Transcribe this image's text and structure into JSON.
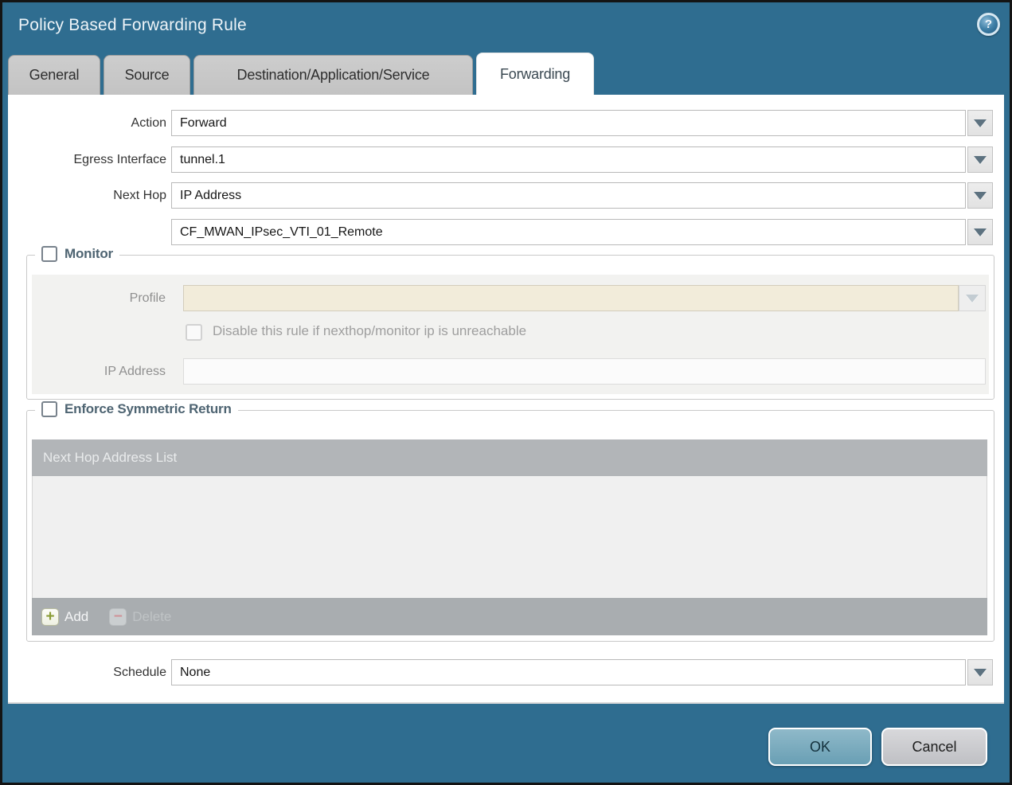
{
  "window": {
    "title": "Policy Based Forwarding Rule"
  },
  "tabs": [
    {
      "label": "General",
      "active": false
    },
    {
      "label": "Source",
      "active": false
    },
    {
      "label": "Destination/Application/Service",
      "active": false
    },
    {
      "label": "Forwarding",
      "active": true
    }
  ],
  "form": {
    "action": {
      "label": "Action",
      "value": "Forward"
    },
    "egress_interface": {
      "label": "Egress Interface",
      "value": "tunnel.1"
    },
    "next_hop": {
      "label": "Next Hop",
      "value": "IP Address"
    },
    "next_hop_value": {
      "value": "CF_MWAN_IPsec_VTI_01_Remote"
    },
    "schedule": {
      "label": "Schedule",
      "value": "None"
    }
  },
  "monitor": {
    "label": "Monitor",
    "checked": false,
    "profile": {
      "label": "Profile",
      "value": ""
    },
    "disable_rule": {
      "label": "Disable this rule if nexthop/monitor ip is unreachable",
      "checked": false
    },
    "ip_address": {
      "label": "IP Address",
      "value": ""
    }
  },
  "enforce_symmetric_return": {
    "label": "Enforce Symmetric Return",
    "checked": false,
    "table": {
      "header": "Next Hop Address List",
      "rows": []
    },
    "add_label": "Add",
    "delete_label": "Delete"
  },
  "footer": {
    "ok_label": "OK",
    "cancel_label": "Cancel"
  },
  "icons": {
    "help": "help-icon",
    "dropdown": "chevron-down-icon",
    "add": "plus-icon",
    "delete": "minus-icon",
    "help_glyph": "?",
    "add_glyph": "+",
    "delete_glyph": "−"
  },
  "colors": {
    "titlebar": "#2f6d90",
    "tab_inactive": "#c6c6c6",
    "disabled_field": "#f2ecda",
    "table_header": "#b2b5b8",
    "ok_button": "#74a9bd",
    "cancel_button": "#c9cacd"
  }
}
